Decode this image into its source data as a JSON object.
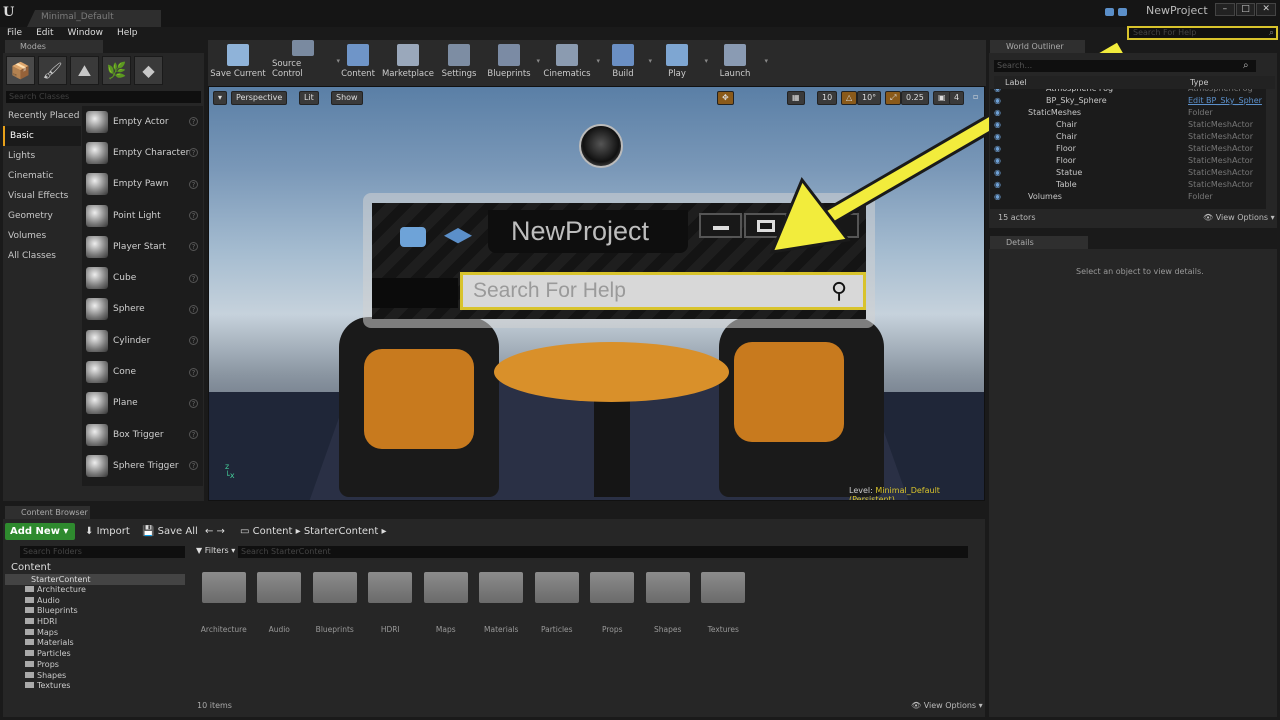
{
  "titlebar": {
    "doc_tab": "Minimal_Default",
    "project": "NewProject",
    "logo": "U"
  },
  "menu": [
    "File",
    "Edit",
    "Window",
    "Help"
  ],
  "help_search": {
    "placeholder": "Search For Help"
  },
  "modes": {
    "tab": "Modes",
    "search_placeholder": "Search Classes",
    "categories": [
      "Recently Placed",
      "Basic",
      "Lights",
      "Cinematic",
      "Visual Effects",
      "Geometry",
      "Volumes",
      "All Classes"
    ],
    "selected_category": "Basic",
    "actors": [
      "Empty Actor",
      "Empty Character",
      "Empty Pawn",
      "Point Light",
      "Player Start",
      "Cube",
      "Sphere",
      "Cylinder",
      "Cone",
      "Plane",
      "Box Trigger",
      "Sphere Trigger"
    ]
  },
  "toolbar": [
    {
      "label": "Save Current",
      "icon": "save-icon",
      "color": "#8fb3d9"
    },
    {
      "label": "Source Control",
      "icon": "source-control-icon",
      "color": "#7a8aa0"
    },
    {
      "label": "Content",
      "icon": "content-icon",
      "color": "#6f95c8"
    },
    {
      "label": "Marketplace",
      "icon": "marketplace-icon",
      "color": "#9aa8bb"
    },
    {
      "label": "Settings",
      "icon": "settings-icon",
      "color": "#7d8da3"
    },
    {
      "label": "Blueprints",
      "icon": "blueprints-icon",
      "color": "#7b8ba4"
    },
    {
      "label": "Cinematics",
      "icon": "cinematics-icon",
      "color": "#8b9bb0"
    },
    {
      "label": "Build",
      "icon": "build-icon",
      "color": "#6a8fc4"
    },
    {
      "label": "Play",
      "icon": "play-icon",
      "color": "#7ea6d2"
    },
    {
      "label": "Launch",
      "icon": "launch-icon",
      "color": "#8a9bb3"
    }
  ],
  "viewport": {
    "perspective": "Perspective",
    "lit": "Lit",
    "show": "Show",
    "grid": "10",
    "angle": "10°",
    "scale": "0.25",
    "cam": "4",
    "level_prefix": "Level:",
    "level_name": "Minimal_Default (Persistent)"
  },
  "callout": {
    "title": "NewProject",
    "search_placeholder": "Search For Help"
  },
  "outliner": {
    "tab": "World Outliner",
    "search_placeholder": "Search...",
    "col_label": "Label",
    "col_type": "Type",
    "rows": [
      {
        "name": "Atmospheric Fog",
        "type": "AtmosphericFog",
        "indent": 0,
        "link": false
      },
      {
        "name": "BP_Sky_Sphere",
        "type": "Edit BP_Sky_Spher",
        "indent": 0,
        "link": true
      },
      {
        "name": "StaticMeshes",
        "type": "Folder",
        "indent": 1,
        "link": false
      },
      {
        "name": "Chair",
        "type": "StaticMeshActor",
        "indent": 2,
        "link": false
      },
      {
        "name": "Chair",
        "type": "StaticMeshActor",
        "indent": 2,
        "link": false
      },
      {
        "name": "Floor",
        "type": "StaticMeshActor",
        "indent": 2,
        "link": false
      },
      {
        "name": "Floor",
        "type": "StaticMeshActor",
        "indent": 2,
        "link": false
      },
      {
        "name": "Statue",
        "type": "StaticMeshActor",
        "indent": 2,
        "link": false
      },
      {
        "name": "Table",
        "type": "StaticMeshActor",
        "indent": 2,
        "link": false
      },
      {
        "name": "Volumes",
        "type": "Folder",
        "indent": 1,
        "link": false
      }
    ],
    "count": "15 actors",
    "view_options": "View Options"
  },
  "details": {
    "tab": "Details",
    "message": "Select an object to view details."
  },
  "content_browser": {
    "tab": "Content Browser",
    "add_new": "Add New",
    "import": "Import",
    "save_all": "Save All",
    "path_root": "Content",
    "path_sub": "StarterContent",
    "folder_search": "Search Folders",
    "filters": "Filters",
    "asset_search": "Search StarterContent",
    "tree_root": "Content",
    "tree_selected": "StarterContent",
    "tree": [
      "Architecture",
      "Audio",
      "Blueprints",
      "HDRI",
      "Maps",
      "Materials",
      "Particles",
      "Props",
      "Shapes",
      "Textures"
    ],
    "folders": [
      "Architecture",
      "Audio",
      "Blueprints",
      "HDRI",
      "Maps",
      "Materials",
      "Particles",
      "Props",
      "Shapes",
      "Textures"
    ],
    "items": "10 items",
    "view_options": "View Options"
  },
  "colors": {
    "highlight": "#d8c32c",
    "add_new": "#2e8a2e",
    "arrow": "#f2ec3c"
  }
}
